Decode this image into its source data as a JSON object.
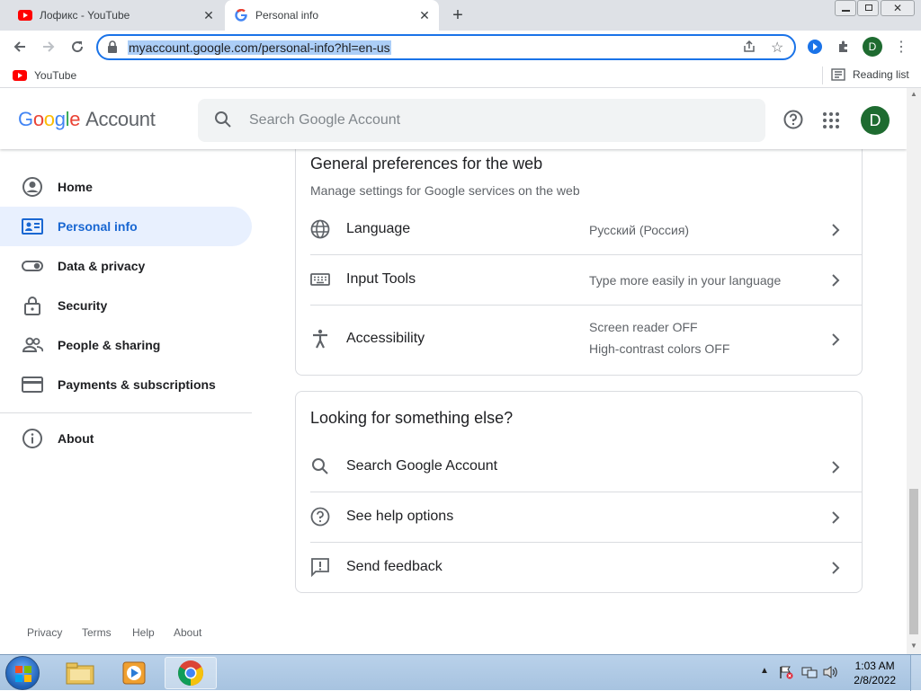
{
  "browser": {
    "tabs": [
      {
        "title": "Лофикс - YouTube",
        "active": false
      },
      {
        "title": "Personal info",
        "active": true
      }
    ],
    "url": "myaccount.google.com/personal-info?hl=en-us",
    "profile_initial": "D",
    "bookmarks": [
      {
        "label": "YouTube"
      }
    ],
    "reading_list_label": "Reading list"
  },
  "header": {
    "logo_google": "Google",
    "logo_account": "Account",
    "search_placeholder": "Search Google Account",
    "avatar_initial": "D"
  },
  "sidebar": {
    "items": [
      {
        "label": "Home",
        "icon": "account-circle-icon"
      },
      {
        "label": "Personal info",
        "icon": "id-card-icon",
        "active": true
      },
      {
        "label": "Data & privacy",
        "icon": "toggle-icon"
      },
      {
        "label": "Security",
        "icon": "lock-icon"
      },
      {
        "label": "People & sharing",
        "icon": "people-icon"
      },
      {
        "label": "Payments & subscriptions",
        "icon": "credit-card-icon"
      }
    ],
    "about": {
      "label": "About",
      "icon": "info-icon"
    }
  },
  "general_prefs": {
    "title": "General preferences for the web",
    "subtitle": "Manage settings for Google services on the web",
    "rows": [
      {
        "label": "Language",
        "value": "Русский (Россия)",
        "icon": "globe-icon"
      },
      {
        "label": "Input Tools",
        "value": "Type more easily in your language",
        "icon": "keyboard-icon"
      },
      {
        "label": "Accessibility",
        "value_line1": "Screen reader OFF",
        "value_line2": "High-contrast colors OFF",
        "icon": "accessibility-icon"
      }
    ]
  },
  "looking": {
    "title": "Looking for something else?",
    "rows": [
      {
        "label": "Search Google Account",
        "icon": "search-icon"
      },
      {
        "label": "See help options",
        "icon": "help-icon"
      },
      {
        "label": "Send feedback",
        "icon": "feedback-icon"
      }
    ]
  },
  "footer": {
    "links": [
      "Privacy",
      "Terms",
      "Help",
      "About"
    ]
  },
  "taskbar": {
    "time": "1:03 AM",
    "date": "2/8/2022"
  },
  "colors": {
    "google_blue": "#4285f4",
    "google_red": "#ea4335",
    "google_yellow": "#fbbc05",
    "google_green": "#34a853",
    "active_nav_bg": "#e8f0fe",
    "active_nav_text": "#1967d2",
    "avatar_bg": "#1e6b30"
  }
}
